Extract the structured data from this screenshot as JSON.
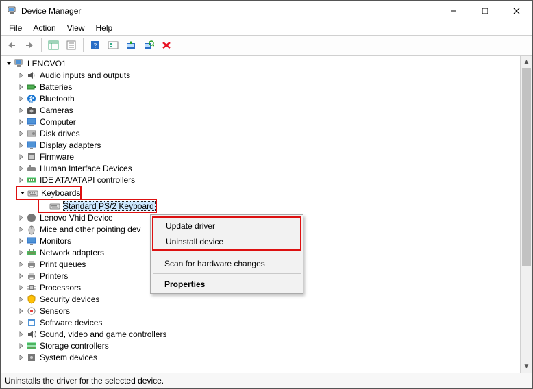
{
  "window": {
    "title": "Device Manager"
  },
  "menu": {
    "file": "File",
    "action": "Action",
    "view": "View",
    "help": "Help"
  },
  "tree": {
    "root": "LENOVO1",
    "categories": [
      {
        "icon": "audio-icon",
        "label": "Audio inputs and outputs"
      },
      {
        "icon": "battery-icon",
        "label": "Batteries"
      },
      {
        "icon": "bluetooth-icon",
        "label": "Bluetooth"
      },
      {
        "icon": "camera-icon",
        "label": "Cameras"
      },
      {
        "icon": "computer-icon",
        "label": "Computer"
      },
      {
        "icon": "disk-icon",
        "label": "Disk drives"
      },
      {
        "icon": "display-icon",
        "label": "Display adapters"
      },
      {
        "icon": "firmware-icon",
        "label": "Firmware"
      },
      {
        "icon": "hid-icon",
        "label": "Human Interface Devices"
      },
      {
        "icon": "ide-icon",
        "label": "IDE ATA/ATAPI controllers"
      },
      {
        "icon": "keyboard-icon",
        "label": "Keyboards",
        "children": [
          {
            "icon": "keyboard-icon",
            "label": "Standard PS/2 Keyboard"
          }
        ]
      },
      {
        "icon": "lenovo-icon",
        "label": "Lenovo Vhid Device"
      },
      {
        "icon": "mouse-icon",
        "label": "Mice and other pointing devices"
      },
      {
        "icon": "monitor-icon",
        "label": "Monitors"
      },
      {
        "icon": "network-icon",
        "label": "Network adapters"
      },
      {
        "icon": "printq-icon",
        "label": "Print queues"
      },
      {
        "icon": "printer-icon",
        "label": "Printers"
      },
      {
        "icon": "cpu-icon",
        "label": "Processors"
      },
      {
        "icon": "security-icon",
        "label": "Security devices"
      },
      {
        "icon": "sensor-icon",
        "label": "Sensors"
      },
      {
        "icon": "software-icon",
        "label": "Software devices"
      },
      {
        "icon": "sound-icon",
        "label": "Sound, video and game controllers"
      },
      {
        "icon": "storage-icon",
        "label": "Storage controllers"
      },
      {
        "icon": "system-icon",
        "label": "System devices"
      }
    ]
  },
  "ctx": {
    "update": "Update driver",
    "uninstall": "Uninstall device",
    "scan": "Scan for hardware changes",
    "props": "Properties"
  },
  "status": "Uninstalls the driver for the selected device."
}
